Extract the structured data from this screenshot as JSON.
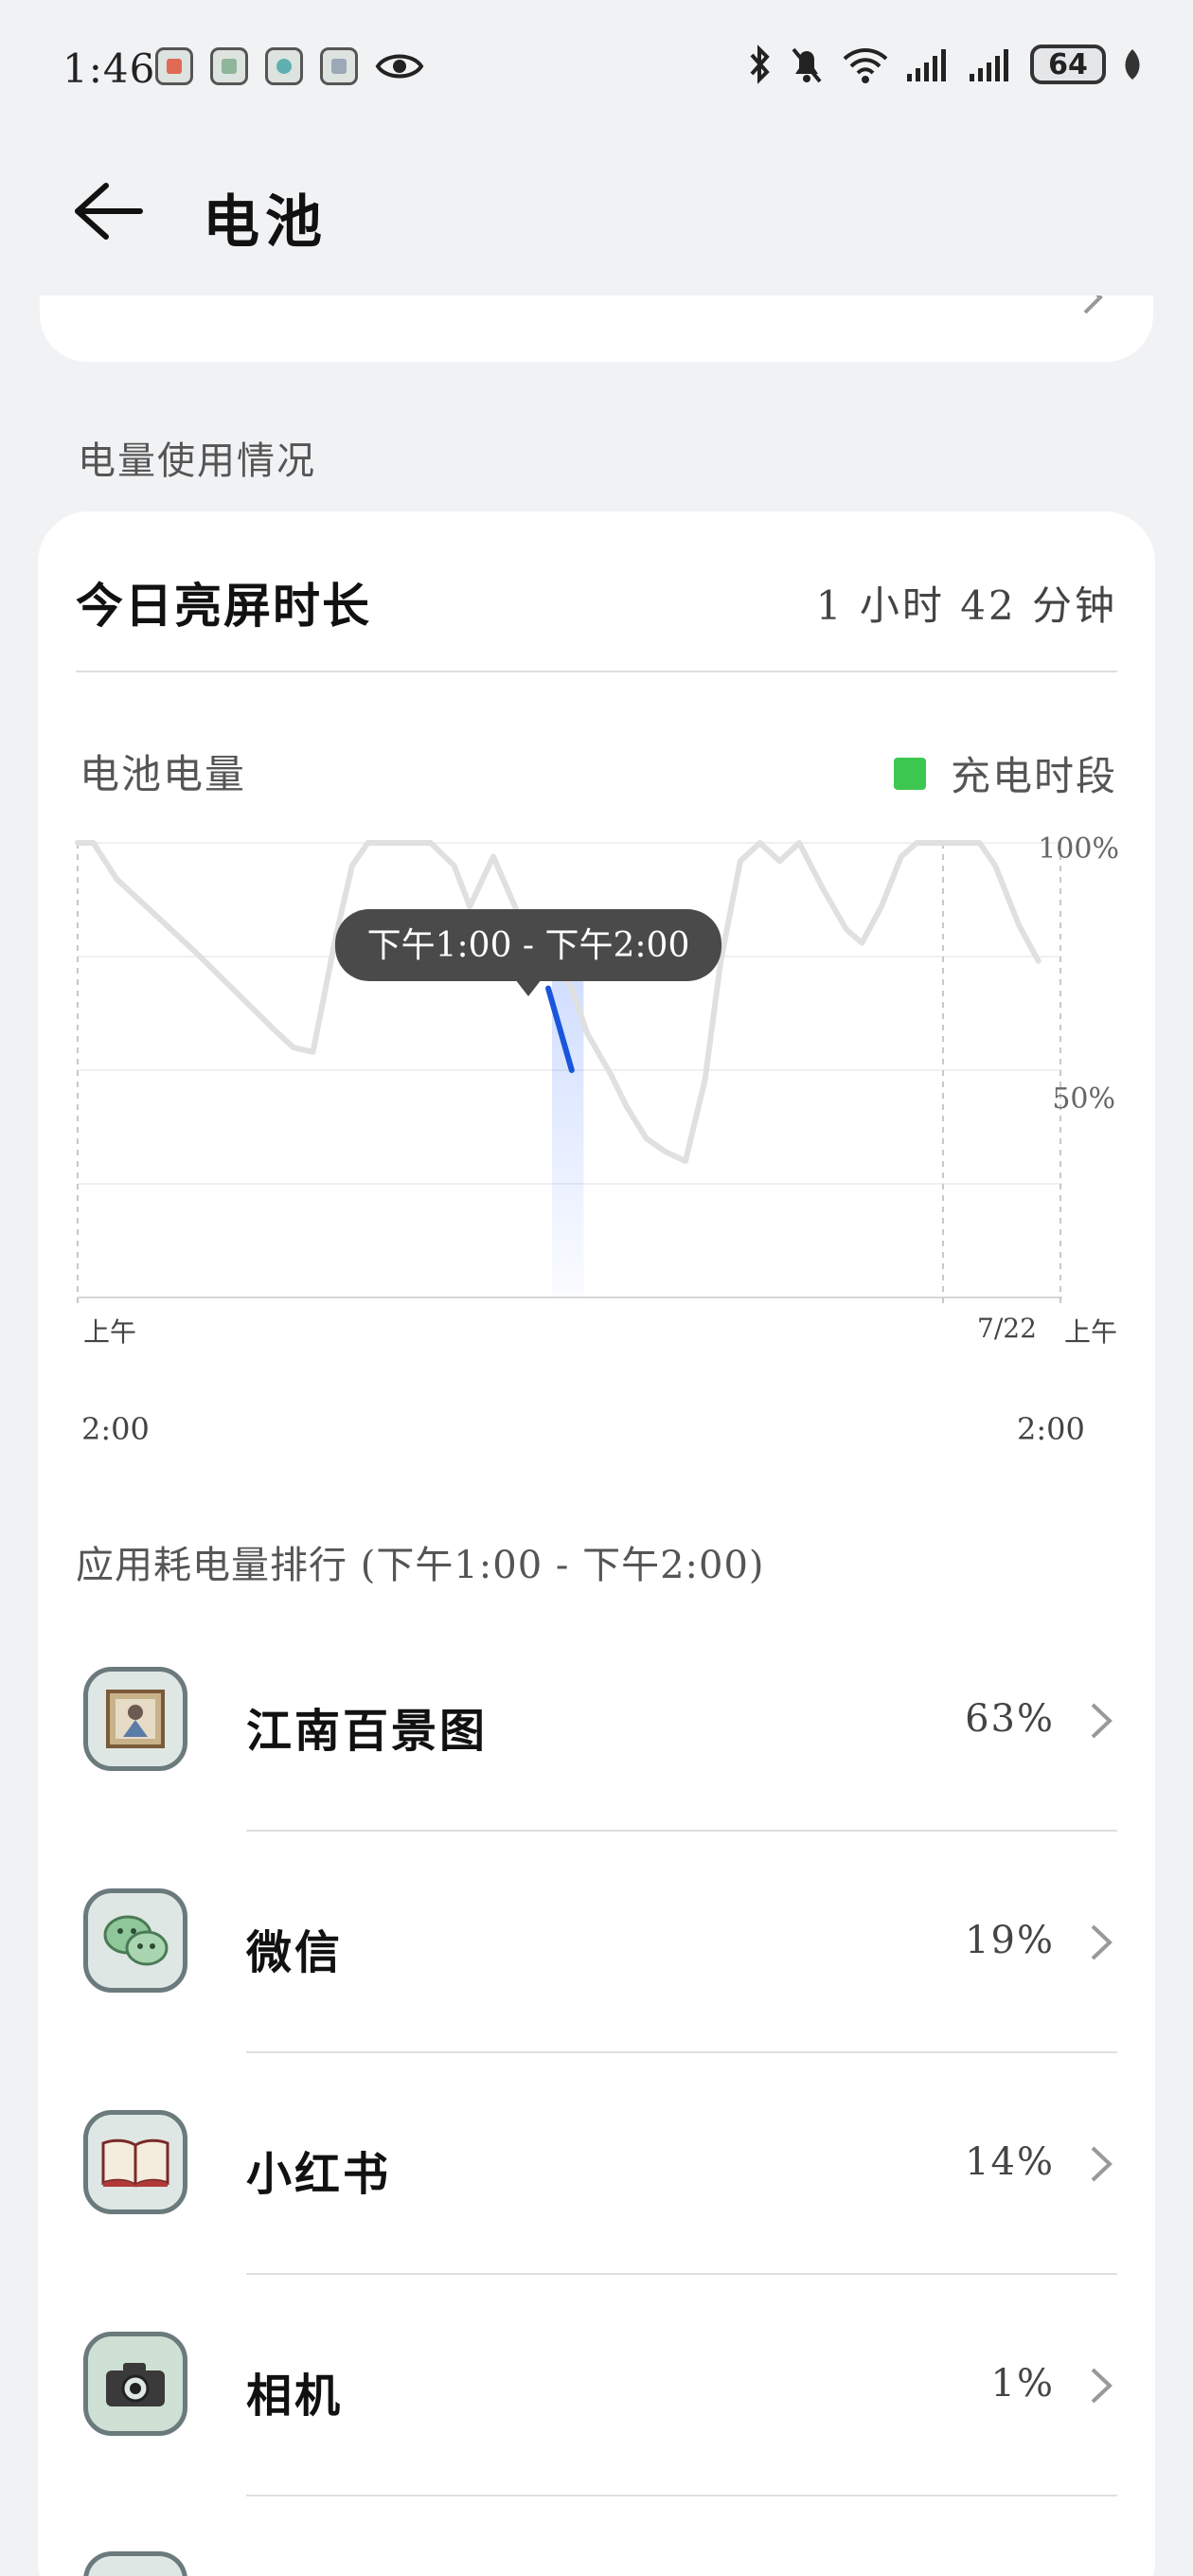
{
  "status_bar": {
    "time": "1:46",
    "battery_level": "64",
    "notification_icons": [
      "pdf-app-icon",
      "image-app-icon",
      "map-app-icon",
      "photo-app-icon",
      "eye-icon"
    ],
    "system_icons": [
      "bluetooth-icon",
      "mute-bell-icon",
      "wifi-icon",
      "signal-icon",
      "signal-icon",
      "battery-icon",
      "leaf-icon"
    ]
  },
  "header": {
    "title": "电池",
    "back_icon": "arrow-left-icon"
  },
  "section": {
    "usage_label": "电量使用情况"
  },
  "screen_time": {
    "label": "今日亮屏时长",
    "value": "1 小时 42 分钟"
  },
  "battery_chart": {
    "label": "电池电量",
    "legend_label": "充电时段",
    "legend_color": "#3cc850",
    "line_color": "#e0e0e0",
    "highlight_color": "#1a56db",
    "tooltip": "下午1:00 - 下午2:00",
    "x_left_line1": "上午",
    "x_left_line2": "2:00",
    "x_mid": "7/22",
    "x_right_line1": "上午",
    "x_right_line2": "2:00",
    "y_top": "100%",
    "y_mid": "50%"
  },
  "chart_data": {
    "type": "line",
    "x_unit": "hours since 上午2:00",
    "xlim": [
      0,
      24
    ],
    "ylim": [
      0,
      100
    ],
    "series": [
      {
        "values": [
          [
            0,
            100
          ],
          [
            0.4,
            100
          ],
          [
            1,
            92
          ],
          [
            3,
            76
          ],
          [
            5,
            59
          ],
          [
            5.5,
            55
          ],
          [
            6,
            54
          ],
          [
            6.6,
            80
          ],
          [
            7,
            95
          ],
          [
            7.4,
            100
          ],
          [
            9,
            100
          ],
          [
            9.6,
            95
          ],
          [
            10,
            86
          ],
          [
            10.6,
            97
          ],
          [
            11.3,
            83
          ],
          [
            12,
            76
          ],
          [
            12.6,
            68
          ],
          [
            13,
            58
          ],
          [
            13.6,
            49
          ],
          [
            14,
            42
          ],
          [
            14.5,
            35
          ],
          [
            15,
            32
          ],
          [
            15.5,
            30
          ],
          [
            16,
            48
          ],
          [
            16.4,
            74
          ],
          [
            16.9,
            96
          ],
          [
            17.4,
            100
          ],
          [
            17.9,
            96
          ],
          [
            18.4,
            100
          ],
          [
            19,
            90
          ],
          [
            19.6,
            81
          ],
          [
            20,
            78
          ],
          [
            20.5,
            86
          ],
          [
            21,
            97
          ],
          [
            21.4,
            100
          ],
          [
            23,
            100
          ],
          [
            23.4,
            95
          ],
          [
            24,
            82
          ],
          [
            24.5,
            74
          ]
        ]
      }
    ],
    "highlight": {
      "x_range": [
        12,
        13
      ],
      "values": [
        [
          12,
          68
        ],
        [
          12.6,
          50
        ]
      ]
    },
    "legend_placement": "top-right",
    "grid": true
  },
  "app_ranking": {
    "header": "应用耗电量排行 (下午1:00 - 下午2:00)",
    "apps": [
      {
        "name": "江南百景图",
        "percent": "63%",
        "icon": "painting-icon"
      },
      {
        "name": "微信",
        "percent": "19%",
        "icon": "wechat-icon"
      },
      {
        "name": "小红书",
        "percent": "14%",
        "icon": "book-icon"
      },
      {
        "name": "相机",
        "percent": "1%",
        "icon": "camera-icon"
      }
    ]
  }
}
